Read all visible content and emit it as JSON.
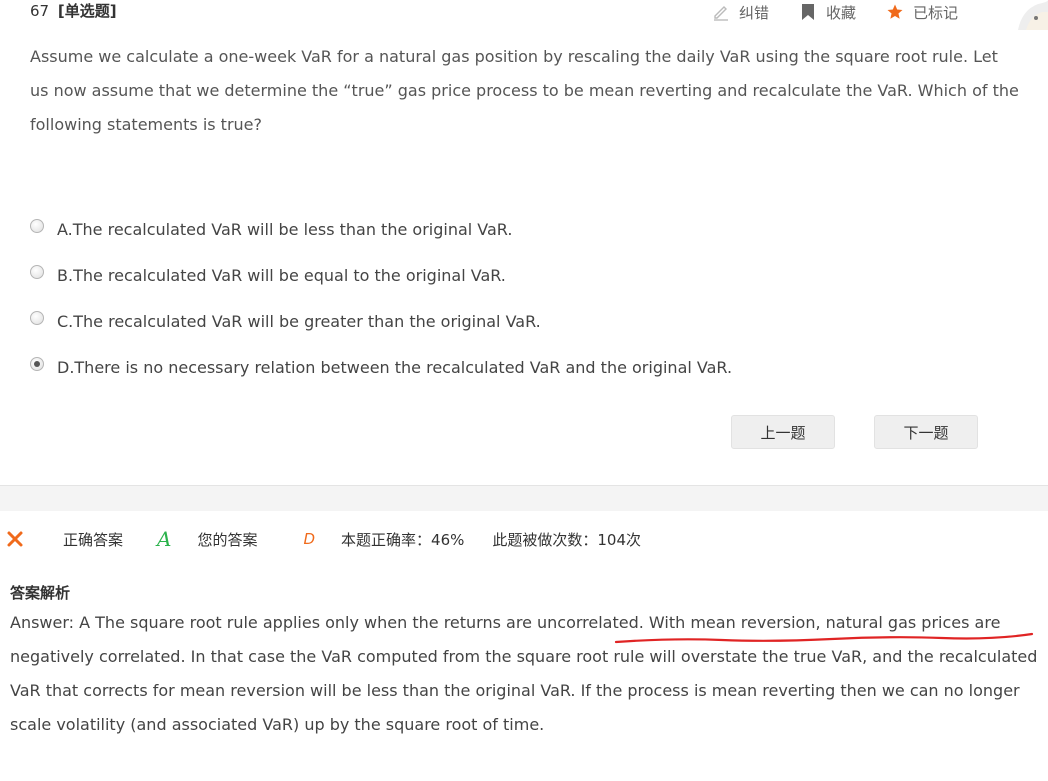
{
  "question": {
    "number": "67",
    "type": "[单选题]",
    "stem": "Assume we calculate a one-week VaR for a natural gas position by rescaling the daily VaR using the square root rule. Let us now assume that we determine the  “true”  gas price process to be mean reverting and recalculate the VaR. Which of the following statements is true?"
  },
  "toolbar": {
    "report_label": "纠错",
    "favorite_label": "收藏",
    "marked_label": "已标记",
    "marked_color": "#f06a1b"
  },
  "options": [
    {
      "text": "A.The recalculated VaR will be less than the original VaR.",
      "checked": false
    },
    {
      "text": "B.The recalculated VaR will be equal to the original VaR.",
      "checked": false
    },
    {
      "text": "C.The recalculated VaR will be greater than the original VaR.",
      "checked": false
    },
    {
      "text": "D.There is no necessary relation between the recalculated VaR and the original VaR.",
      "checked": true
    }
  ],
  "nav": {
    "prev_label": "上一题",
    "next_label": "下一题"
  },
  "result": {
    "status_icon": "wrong-x-icon",
    "correct_label": "正确答案",
    "correct_answer": "A",
    "your_label": "您的答案",
    "your_answer": "D",
    "accuracy": "本题正确率：46%",
    "attempts": "此题被做次数：104次",
    "correct_color": "#2bb24c",
    "wrong_color": "#f06a1b"
  },
  "analysis": {
    "title": "答案解析",
    "text": "Answer: A The square root rule applies only when the returns are uncorrelated. With mean reversion, natural gas prices are negatively correlated. In that case the VaR computed from the square root rule will overstate the true VaR, and the recalculated VaR that corrects for mean reversion will be less than the original VaR. If the process is mean reverting then we can no longer scale volatility (and associated VaR) up by the square root of time."
  }
}
